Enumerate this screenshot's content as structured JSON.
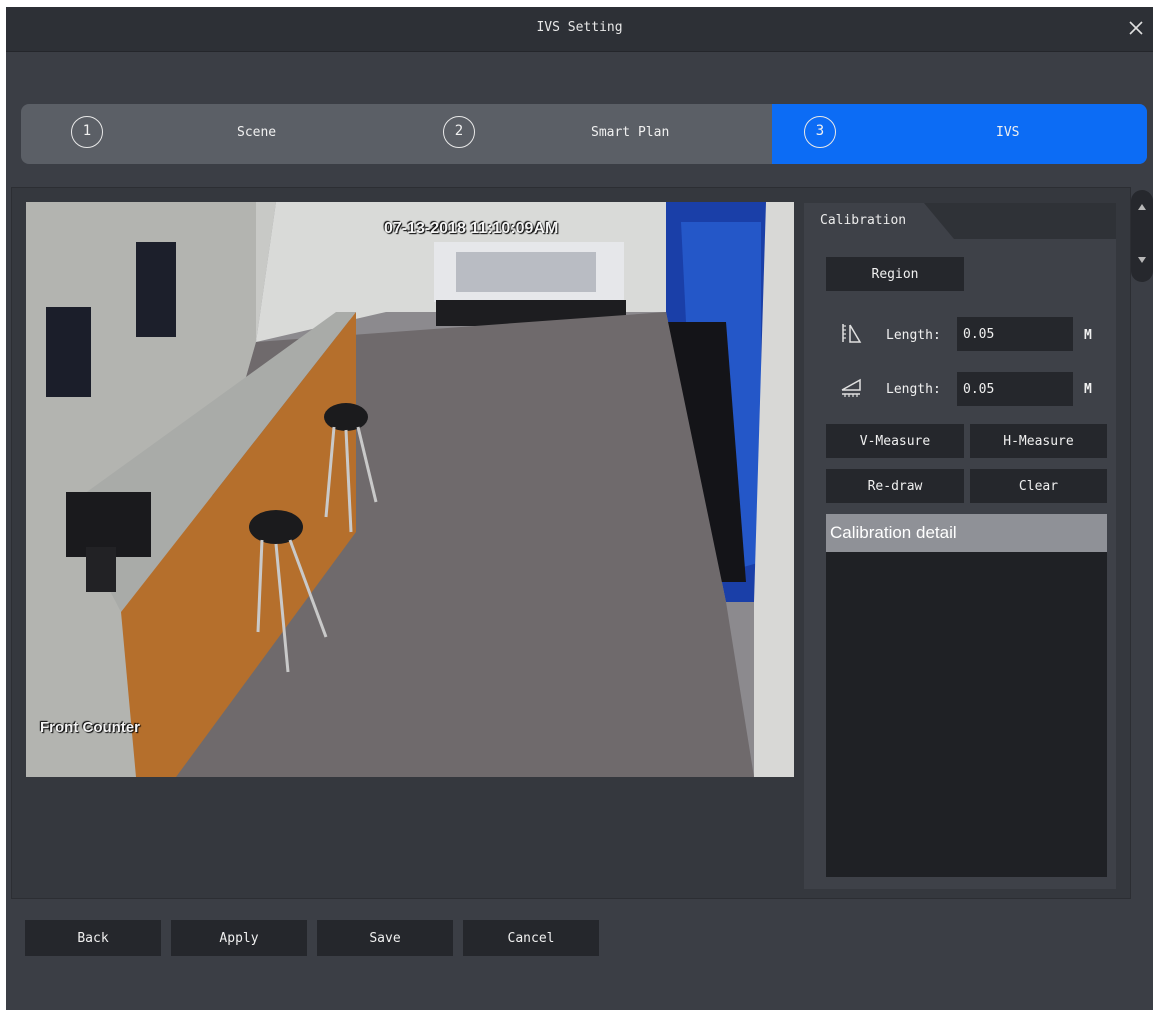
{
  "window": {
    "title": "IVS Setting",
    "close_icon": "close-icon"
  },
  "steps": [
    {
      "number": "1",
      "label": "Scene",
      "active": false
    },
    {
      "number": "2",
      "label": "Smart Plan",
      "active": false
    },
    {
      "number": "3",
      "label": "IVS",
      "active": true
    }
  ],
  "video": {
    "timestamp": "07-13-2018 11:10:09AM",
    "camera_label": "Front Counter"
  },
  "calibration": {
    "tab_label": "Calibration",
    "region_button": "Region",
    "vertical": {
      "icon": "vertical-ruler-icon",
      "label": "Length:",
      "value": "0.05",
      "unit": "M"
    },
    "horizontal": {
      "icon": "horizontal-ruler-icon",
      "label": "Length:",
      "value": "0.05",
      "unit": "M"
    },
    "v_measure_button": "V-Measure",
    "h_measure_button": "H-Measure",
    "redraw_button": "Re-draw",
    "clear_button": "Clear",
    "detail_header": "Calibration detail"
  },
  "footer": {
    "back": "Back",
    "apply": "Apply",
    "save": "Save",
    "cancel": "Cancel"
  },
  "colors": {
    "active_step": "#0c6cf5",
    "background": "#3b3e45",
    "button": "#25272c"
  }
}
